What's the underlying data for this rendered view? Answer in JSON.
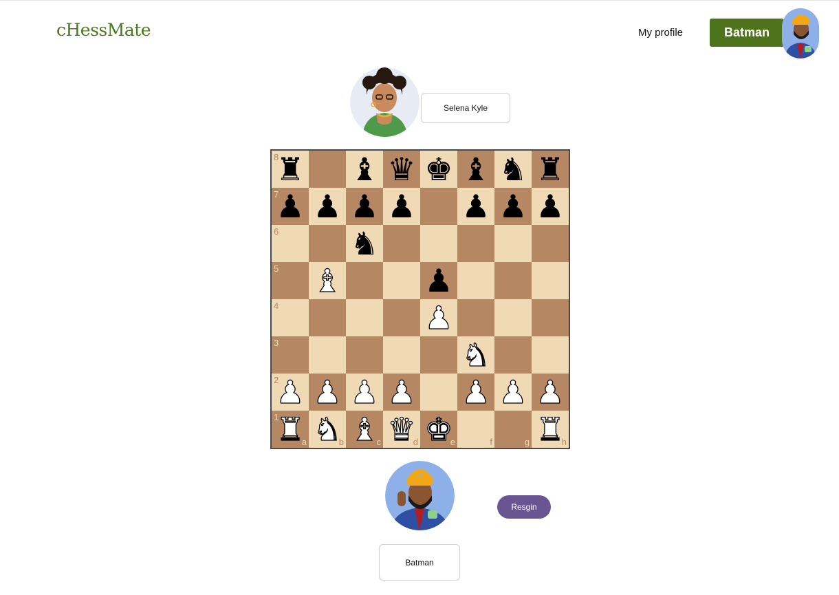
{
  "header": {
    "logo": "cHessMate",
    "nav_profile": "My profile",
    "user_button": "Batman"
  },
  "opponent": {
    "name": "Selena Kyle"
  },
  "player": {
    "name": "Batman"
  },
  "actions": {
    "resign": "Resgin"
  },
  "board": {
    "files": [
      "a",
      "b",
      "c",
      "d",
      "e",
      "f",
      "g",
      "h"
    ],
    "ranks": [
      "8",
      "7",
      "6",
      "5",
      "4",
      "3",
      "2",
      "1"
    ],
    "position": [
      [
        "bR",
        "",
        "bB",
        "bQ",
        "bK",
        "bB",
        "bN",
        "bR"
      ],
      [
        "bP",
        "bP",
        "bP",
        "bP",
        "",
        "bP",
        "bP",
        "bP"
      ],
      [
        "",
        "",
        "bN",
        "",
        "",
        "",
        "",
        ""
      ],
      [
        "",
        "wB",
        "",
        "",
        "bP",
        "",
        "",
        ""
      ],
      [
        "",
        "",
        "",
        "",
        "wP",
        "",
        "",
        ""
      ],
      [
        "",
        "",
        "",
        "",
        "",
        "wN",
        "",
        ""
      ],
      [
        "wP",
        "wP",
        "wP",
        "wP",
        "",
        "wP",
        "wP",
        "wP"
      ],
      [
        "wR",
        "wN",
        "wB",
        "wQ",
        "wK",
        "",
        "",
        "wR"
      ]
    ],
    "colors": {
      "light": "#f0d9b5",
      "dark": "#b58863"
    }
  },
  "colors": {
    "brand": "#4f731d",
    "resign": "#6a5593"
  }
}
